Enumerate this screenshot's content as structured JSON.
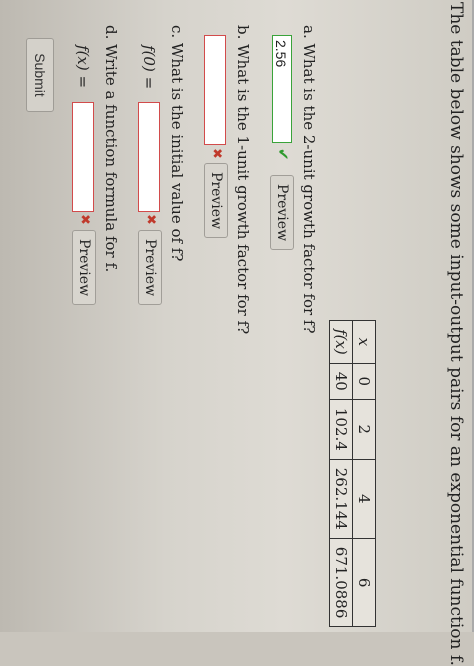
{
  "question": {
    "intro": "The table below shows some input-output pairs for an exponential function f.",
    "table": {
      "header_x": "x",
      "header_fx": "f(x)",
      "x_values": [
        "0",
        "2",
        "4",
        "6"
      ],
      "fx_values": [
        "40",
        "102.4",
        "262.144",
        "671.0886"
      ]
    }
  },
  "parts": {
    "a": {
      "label": "a. What is the 2-unit growth factor for f?",
      "value": "2.56",
      "status_icon": "check-icon",
      "preview_label": "Preview"
    },
    "b": {
      "label": "b. What is the 1-unit growth factor for f?",
      "value": "",
      "status_icon": "x-icon",
      "preview_label": "Preview"
    },
    "c": {
      "label": "c. What is the initial value of f?",
      "prefix": "f(0) =",
      "value": "",
      "status_icon": "x-icon",
      "preview_label": "Preview"
    },
    "d": {
      "label": "d. Write a function formula for f.",
      "prefix": "f(x) =",
      "value": "",
      "status_icon": "x-icon",
      "preview_label": "Preview"
    }
  },
  "submit_label": "Submit",
  "colors": {
    "correct_border": "#3aa33a",
    "incorrect_border": "#d24b4b",
    "check_mark": "#2e9a2e",
    "x_mark": "#c0392b"
  }
}
